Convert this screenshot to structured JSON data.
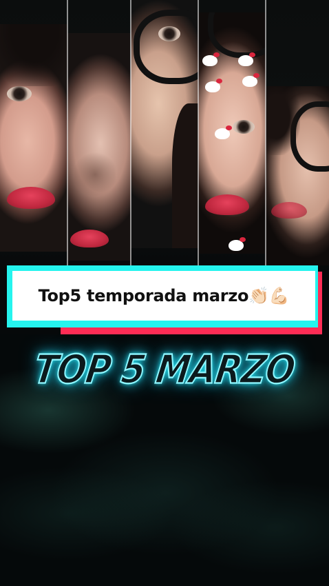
{
  "caption": {
    "text": "Top5 temporada marzo👏🏻💪🏻"
  },
  "overlay": {
    "neon_title": "TOP 5 MARZO"
  },
  "colors": {
    "caption_cyan": "#25f4ee",
    "caption_red": "#fe2c55",
    "neon": "#25e6f0",
    "background": "#06090a"
  }
}
